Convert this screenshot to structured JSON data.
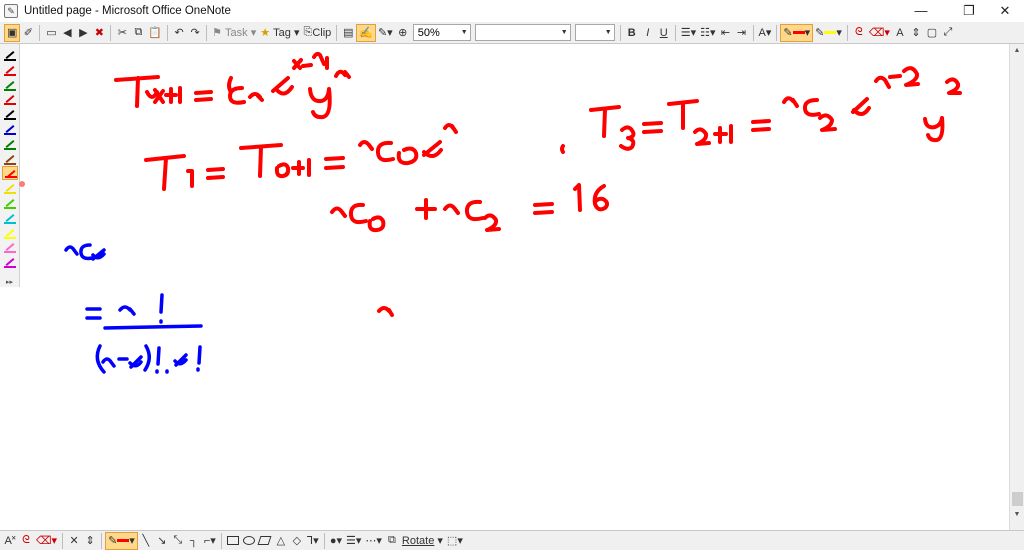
{
  "window": {
    "title": "Untitled page - Microsoft Office OneNote",
    "app_icon": "onenote-icon",
    "controls": [
      "minimize",
      "restore",
      "close"
    ]
  },
  "toolbar": {
    "task_label": "Task",
    "tag_label": "Tag",
    "clip_label": "Clip",
    "zoom_value": "50%",
    "font_name": "",
    "font_size": "",
    "bold": "B",
    "italic": "I",
    "underline": "U"
  },
  "pens": [
    {
      "name": "black",
      "color": "#000000"
    },
    {
      "name": "red",
      "color": "#e00000"
    },
    {
      "name": "green",
      "color": "#008000"
    },
    {
      "name": "red-2",
      "color": "#e00000"
    },
    {
      "name": "black-2",
      "color": "#000000"
    },
    {
      "name": "blue",
      "color": "#0000cc"
    },
    {
      "name": "green-2",
      "color": "#008000"
    },
    {
      "name": "brown",
      "color": "#8b4513"
    },
    {
      "name": "red-active",
      "color": "#ff0000"
    },
    {
      "name": "yellow",
      "color": "#f0e000"
    },
    {
      "name": "lime",
      "color": "#44cc00"
    },
    {
      "name": "cyan",
      "color": "#00c0d0"
    },
    {
      "name": "yellow-2",
      "color": "#ffff00"
    },
    {
      "name": "pink",
      "color": "#ff66cc"
    },
    {
      "name": "magenta",
      "color": "#d000d0"
    }
  ],
  "ink": {
    "red": "#ff0000",
    "blue": "#0000ff"
  },
  "drawbar": {
    "rotate_label": "Rotate",
    "text_tool": "A"
  }
}
